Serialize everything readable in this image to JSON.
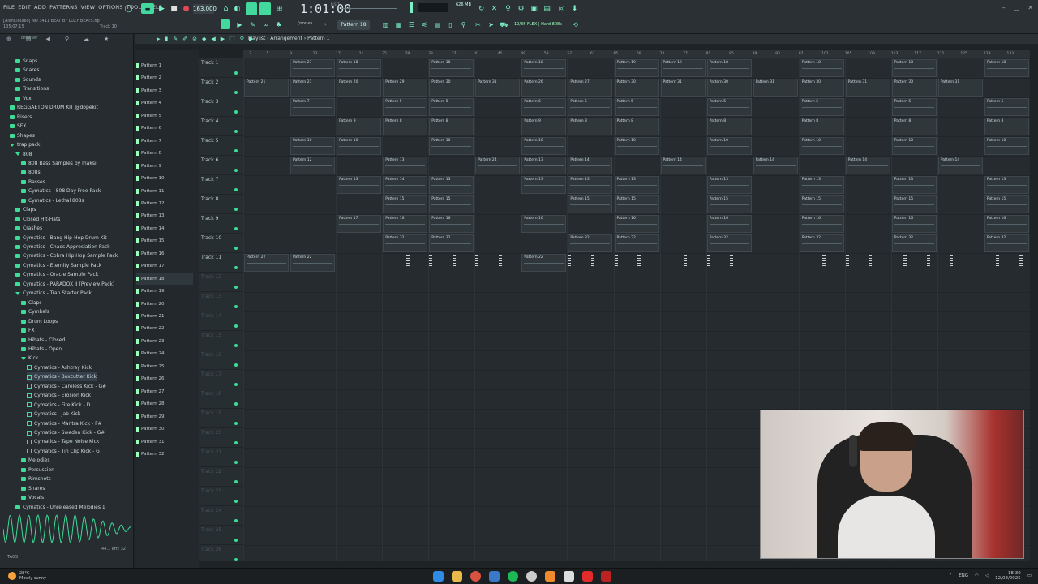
{
  "menu": [
    "FILE",
    "EDIT",
    "ADD",
    "PATTERNS",
    "VIEW",
    "OPTIONS",
    "TOOLS",
    "HELP"
  ],
  "hint": {
    "line1": "[AllInCloudio] NO 3411 BEAT BY LUZY BEATS.flp",
    "line2": "135:07:15",
    "track_hint": "Track 10"
  },
  "transport": {
    "tempo": "163.000",
    "time": "1:01:00",
    "time_small": "B:S:T",
    "cpu": "626 MB"
  },
  "toolbar2": {
    "mode": "(none)",
    "pattern": "Pattern 18",
    "flex": "10/35 FLEX | Hard 808s"
  },
  "browser": {
    "title": "Browser",
    "items": [
      {
        "label": "Snaps",
        "lvl": 1,
        "t": "folder"
      },
      {
        "label": "Snares",
        "lvl": 1,
        "t": "folder"
      },
      {
        "label": "Sounds",
        "lvl": 1,
        "t": "folder"
      },
      {
        "label": "Transitions",
        "lvl": 1,
        "t": "folder"
      },
      {
        "label": "Vox",
        "lvl": 1,
        "t": "folder"
      },
      {
        "label": "REGGAETON DRUM KIT @dopekit",
        "lvl": 0,
        "t": "folder"
      },
      {
        "label": "Risers",
        "lvl": 0,
        "t": "folder"
      },
      {
        "label": "SFX",
        "lvl": 0,
        "t": "folder"
      },
      {
        "label": "Shapes",
        "lvl": 0,
        "t": "folder"
      },
      {
        "label": "trap pack",
        "lvl": 0,
        "t": "open"
      },
      {
        "label": "808",
        "lvl": 1,
        "t": "open"
      },
      {
        "label": "808 Bass Samples by Ihaksi",
        "lvl": 2,
        "t": "folder"
      },
      {
        "label": "808s",
        "lvl": 2,
        "t": "folder"
      },
      {
        "label": "Basses",
        "lvl": 2,
        "t": "folder"
      },
      {
        "label": "Cymatics - 808 Day Free Pack",
        "lvl": 2,
        "t": "folder"
      },
      {
        "label": "Cymatics - Lethal 808s",
        "lvl": 2,
        "t": "folder"
      },
      {
        "label": "Claps",
        "lvl": 1,
        "t": "folder"
      },
      {
        "label": "Closed Hit-Hats",
        "lvl": 1,
        "t": "folder"
      },
      {
        "label": "Crashes",
        "lvl": 1,
        "t": "folder"
      },
      {
        "label": "Cymatics - Bang Hip-Hop Drum Kit",
        "lvl": 1,
        "t": "folder"
      },
      {
        "label": "Cymatics - Chaos Appreciation Pack",
        "lvl": 1,
        "t": "folder"
      },
      {
        "label": "Cymatics - Cobra Hip Hop Sample Pack",
        "lvl": 1,
        "t": "folder"
      },
      {
        "label": "Cymatics - Eternity Sample Pack",
        "lvl": 1,
        "t": "folder"
      },
      {
        "label": "Cymatics - Oracle Sample Pack",
        "lvl": 1,
        "t": "folder"
      },
      {
        "label": "Cymatics - PARADOX II (Preview Pack)",
        "lvl": 1,
        "t": "folder"
      },
      {
        "label": "Cymatics - Trap Starter Pack",
        "lvl": 1,
        "t": "open"
      },
      {
        "label": "Claps",
        "lvl": 2,
        "t": "folder"
      },
      {
        "label": "Cymbals",
        "lvl": 2,
        "t": "folder"
      },
      {
        "label": "Drum Loops",
        "lvl": 2,
        "t": "folder"
      },
      {
        "label": "FX",
        "lvl": 2,
        "t": "folder"
      },
      {
        "label": "Hihats - Closed",
        "lvl": 2,
        "t": "folder"
      },
      {
        "label": "Hihats - Open",
        "lvl": 2,
        "t": "folder"
      },
      {
        "label": "Kick",
        "lvl": 2,
        "t": "open"
      },
      {
        "label": "Cymatics - Ashtray Kick",
        "lvl": 3,
        "t": "file"
      },
      {
        "label": "Cymatics - Boxcutter Kick",
        "lvl": 3,
        "t": "file",
        "sel": true
      },
      {
        "label": "Cymatics - Careless Kick - G#",
        "lvl": 3,
        "t": "file"
      },
      {
        "label": "Cymatics - Erosion Kick",
        "lvl": 3,
        "t": "file"
      },
      {
        "label": "Cymatics - Fire Kick - D",
        "lvl": 3,
        "t": "file"
      },
      {
        "label": "Cymatics - Jab Kick",
        "lvl": 3,
        "t": "file"
      },
      {
        "label": "Cymatics - Mantra Kick - F#",
        "lvl": 3,
        "t": "file"
      },
      {
        "label": "Cymatics - Sweden Kick - G#",
        "lvl": 3,
        "t": "file"
      },
      {
        "label": "Cymatics - Tape Noise Kick",
        "lvl": 3,
        "t": "file"
      },
      {
        "label": "Cymatics - Tin Clip Kick - G",
        "lvl": 3,
        "t": "file"
      },
      {
        "label": "Melodies",
        "lvl": 2,
        "t": "folder"
      },
      {
        "label": "Percussion",
        "lvl": 2,
        "t": "folder"
      },
      {
        "label": "Rimshots",
        "lvl": 2,
        "t": "folder"
      },
      {
        "label": "Snares",
        "lvl": 2,
        "t": "folder"
      },
      {
        "label": "Vocals",
        "lvl": 2,
        "t": "folder"
      },
      {
        "label": "Cymatics - Unreleased Melodies 1",
        "lvl": 1,
        "t": "folder"
      }
    ],
    "tags": "TAGS",
    "samplerate": "44.1 kHz 32"
  },
  "playlist": {
    "breadcrumb": "Playlist - Arrangement › Pattern 1"
  },
  "patterns": [
    "Pattern 1",
    "Pattern 2",
    "Pattern 3",
    "Pattern 4",
    "Pattern 5",
    "Pattern 6",
    "Pattern 7",
    "Pattern 8",
    "Pattern 9",
    "Pattern 10",
    "Pattern 11",
    "Pattern 12",
    "Pattern 13",
    "Pattern 14",
    "Pattern 15",
    "Pattern 16",
    "Pattern 17",
    "Pattern 18",
    "Pattern 19",
    "Pattern 20",
    "Pattern 21",
    "Pattern 22",
    "Pattern 23",
    "Pattern 24",
    "Pattern 25",
    "Pattern 26",
    "Pattern 27",
    "Pattern 28",
    "Pattern 29",
    "Pattern 30",
    "Pattern 31",
    "Pattern 32"
  ],
  "tracks": [
    "Track 1",
    "Track 2",
    "Track 3",
    "Track 4",
    "Track 5",
    "Track 6",
    "Track 7",
    "Track 8",
    "Track 9",
    "Track 10",
    "Track 11",
    "Track 12",
    "Track 13",
    "Track 14",
    "Track 15",
    "Track 16",
    "Track 17",
    "Track 18",
    "Track 19",
    "Track 20",
    "Track 21",
    "Track 22",
    "Track 23",
    "Track 24",
    "Track 25",
    "Track 26"
  ],
  "ruler": [
    "2",
    "5",
    "9",
    "13",
    "17",
    "21",
    "25",
    "29",
    "33",
    "37",
    "41",
    "45",
    "49",
    "53",
    "57",
    "61",
    "65",
    "69",
    "73",
    "77",
    "81",
    "85",
    "89",
    "93",
    "97",
    "101",
    "105",
    "109",
    "113",
    "117",
    "121",
    "125",
    "129",
    "133"
  ],
  "clips": [
    {
      "t": 0,
      "b": 4,
      "e": 8,
      "l": "Pattern 27"
    },
    {
      "t": 0,
      "b": 8,
      "e": 12,
      "l": "Pattern 18"
    },
    {
      "t": 0,
      "b": 16,
      "e": 20,
      "l": "Pattern 18"
    },
    {
      "t": 0,
      "b": 24,
      "e": 28,
      "l": "Pattern 18"
    },
    {
      "t": 0,
      "b": 32,
      "e": 36,
      "l": "Pattern 19"
    },
    {
      "t": 0,
      "b": 36,
      "e": 40,
      "l": "Pattern 19"
    },
    {
      "t": 0,
      "b": 40,
      "e": 44,
      "l": "Pattern 18"
    },
    {
      "t": 0,
      "b": 48,
      "e": 52,
      "l": "Pattern 18"
    },
    {
      "t": 0,
      "b": 56,
      "e": 60,
      "l": "Pattern 18"
    },
    {
      "t": 0,
      "b": 64,
      "e": 68,
      "l": "Pattern 18"
    },
    {
      "t": 0,
      "b": 72,
      "e": 76,
      "l": "Pattern 18"
    },
    {
      "t": 1,
      "b": 0,
      "e": 4,
      "l": "Pattern 21"
    },
    {
      "t": 1,
      "b": 4,
      "e": 8,
      "l": "Pattern 21"
    },
    {
      "t": 1,
      "b": 8,
      "e": 12,
      "l": "Pattern 20"
    },
    {
      "t": 1,
      "b": 12,
      "e": 16,
      "l": "Pattern 29"
    },
    {
      "t": 1,
      "b": 16,
      "e": 20,
      "l": "Pattern 30"
    },
    {
      "t": 1,
      "b": 20,
      "e": 24,
      "l": "Pattern 31"
    },
    {
      "t": 1,
      "b": 24,
      "e": 28,
      "l": "Pattern 26"
    },
    {
      "t": 1,
      "b": 28,
      "e": 32,
      "l": "Pattern 27"
    },
    {
      "t": 1,
      "b": 32,
      "e": 36,
      "l": "Pattern 30"
    },
    {
      "t": 1,
      "b": 36,
      "e": 40,
      "l": "Pattern 31"
    },
    {
      "t": 1,
      "b": 40,
      "e": 44,
      "l": "Pattern 30"
    },
    {
      "t": 1,
      "b": 44,
      "e": 48,
      "l": "Pattern 31"
    },
    {
      "t": 1,
      "b": 48,
      "e": 52,
      "l": "Pattern 30"
    },
    {
      "t": 1,
      "b": 52,
      "e": 56,
      "l": "Pattern 31"
    },
    {
      "t": 1,
      "b": 56,
      "e": 60,
      "l": "Pattern 30"
    },
    {
      "t": 1,
      "b": 60,
      "e": 64,
      "l": "Pattern 31"
    },
    {
      "t": 2,
      "b": 4,
      "e": 8,
      "l": "Pattern 7"
    },
    {
      "t": 2,
      "b": 12,
      "e": 16,
      "l": "Pattern 5"
    },
    {
      "t": 2,
      "b": 16,
      "e": 20,
      "l": "Pattern 5"
    },
    {
      "t": 2,
      "b": 24,
      "e": 28,
      "l": "Pattern 6"
    },
    {
      "t": 2,
      "b": 28,
      "e": 32,
      "l": "Pattern 5"
    },
    {
      "t": 2,
      "b": 32,
      "e": 36,
      "l": "Pattern 5"
    },
    {
      "t": 2,
      "b": 40,
      "e": 44,
      "l": "Pattern 5"
    },
    {
      "t": 2,
      "b": 48,
      "e": 52,
      "l": "Pattern 5"
    },
    {
      "t": 2,
      "b": 56,
      "e": 60,
      "l": "Pattern 5"
    },
    {
      "t": 2,
      "b": 64,
      "e": 68,
      "l": "Pattern 5"
    },
    {
      "t": 3,
      "b": 8,
      "e": 12,
      "l": "Pattern 9"
    },
    {
      "t": 3,
      "b": 12,
      "e": 16,
      "l": "Pattern 8"
    },
    {
      "t": 3,
      "b": 16,
      "e": 20,
      "l": "Pattern 8"
    },
    {
      "t": 3,
      "b": 24,
      "e": 28,
      "l": "Pattern 9"
    },
    {
      "t": 3,
      "b": 28,
      "e": 32,
      "l": "Pattern 8"
    },
    {
      "t": 3,
      "b": 32,
      "e": 36,
      "l": "Pattern 8"
    },
    {
      "t": 3,
      "b": 40,
      "e": 44,
      "l": "Pattern 8"
    },
    {
      "t": 3,
      "b": 48,
      "e": 52,
      "l": "Pattern 8"
    },
    {
      "t": 3,
      "b": 56,
      "e": 60,
      "l": "Pattern 8"
    },
    {
      "t": 3,
      "b": 64,
      "e": 68,
      "l": "Pattern 8"
    },
    {
      "t": 4,
      "b": 4,
      "e": 8,
      "l": "Pattern 10"
    },
    {
      "t": 4,
      "b": 8,
      "e": 12,
      "l": "Pattern 10"
    },
    {
      "t": 4,
      "b": 16,
      "e": 20,
      "l": "Pattern 10"
    },
    {
      "t": 4,
      "b": 24,
      "e": 28,
      "l": "Pattern 10"
    },
    {
      "t": 4,
      "b": 32,
      "e": 36,
      "l": "Pattern 10"
    },
    {
      "t": 4,
      "b": 40,
      "e": 44,
      "l": "Pattern 10"
    },
    {
      "t": 4,
      "b": 48,
      "e": 52,
      "l": "Pattern 10"
    },
    {
      "t": 4,
      "b": 56,
      "e": 60,
      "l": "Pattern 10"
    },
    {
      "t": 4,
      "b": 64,
      "e": 68,
      "l": "Pattern 10"
    },
    {
      "t": 5,
      "b": 4,
      "e": 8,
      "l": "Pattern 12"
    },
    {
      "t": 5,
      "b": 12,
      "e": 16,
      "l": "Pattern 13"
    },
    {
      "t": 5,
      "b": 20,
      "e": 24,
      "l": "Pattern 24"
    },
    {
      "t": 5,
      "b": 24,
      "e": 28,
      "l": "Pattern 13"
    },
    {
      "t": 5,
      "b": 28,
      "e": 32,
      "l": "Pattern 14"
    },
    {
      "t": 5,
      "b": 36,
      "e": 40,
      "l": "Pattern 14"
    },
    {
      "t": 5,
      "b": 44,
      "e": 48,
      "l": "Pattern 14"
    },
    {
      "t": 5,
      "b": 52,
      "e": 56,
      "l": "Pattern 14"
    },
    {
      "t": 5,
      "b": 60,
      "e": 64,
      "l": "Pattern 14"
    },
    {
      "t": 5,
      "b": 68,
      "e": 72,
      "l": "Pattern 14"
    },
    {
      "t": 6,
      "b": 8,
      "e": 12,
      "l": "Pattern 13"
    },
    {
      "t": 6,
      "b": 12,
      "e": 16,
      "l": "Pattern 14"
    },
    {
      "t": 6,
      "b": 16,
      "e": 20,
      "l": "Pattern 13"
    },
    {
      "t": 6,
      "b": 24,
      "e": 28,
      "l": "Pattern 13"
    },
    {
      "t": 6,
      "b": 28,
      "e": 32,
      "l": "Pattern 13"
    },
    {
      "t": 6,
      "b": 32,
      "e": 36,
      "l": "Pattern 13"
    },
    {
      "t": 6,
      "b": 40,
      "e": 44,
      "l": "Pattern 13"
    },
    {
      "t": 6,
      "b": 48,
      "e": 52,
      "l": "Pattern 13"
    },
    {
      "t": 6,
      "b": 56,
      "e": 60,
      "l": "Pattern 13"
    },
    {
      "t": 6,
      "b": 64,
      "e": 68,
      "l": "Pattern 13"
    },
    {
      "t": 7,
      "b": 12,
      "e": 16,
      "l": "Pattern 15"
    },
    {
      "t": 7,
      "b": 16,
      "e": 20,
      "l": "Pattern 15"
    },
    {
      "t": 7,
      "b": 28,
      "e": 32,
      "l": "Pattern 15"
    },
    {
      "t": 7,
      "b": 32,
      "e": 36,
      "l": "Pattern 15"
    },
    {
      "t": 7,
      "b": 40,
      "e": 44,
      "l": "Pattern 15"
    },
    {
      "t": 7,
      "b": 48,
      "e": 52,
      "l": "Pattern 15"
    },
    {
      "t": 7,
      "b": 56,
      "e": 60,
      "l": "Pattern 15"
    },
    {
      "t": 7,
      "b": 64,
      "e": 68,
      "l": "Pattern 15"
    },
    {
      "t": 8,
      "b": 8,
      "e": 12,
      "l": "Pattern 17"
    },
    {
      "t": 8,
      "b": 12,
      "e": 16,
      "l": "Pattern 16"
    },
    {
      "t": 8,
      "b": 16,
      "e": 20,
      "l": "Pattern 16"
    },
    {
      "t": 8,
      "b": 24,
      "e": 28,
      "l": "Pattern 16"
    },
    {
      "t": 8,
      "b": 32,
      "e": 36,
      "l": "Pattern 16"
    },
    {
      "t": 8,
      "b": 40,
      "e": 44,
      "l": "Pattern 16"
    },
    {
      "t": 8,
      "b": 48,
      "e": 52,
      "l": "Pattern 16"
    },
    {
      "t": 8,
      "b": 56,
      "e": 60,
      "l": "Pattern 16"
    },
    {
      "t": 8,
      "b": 64,
      "e": 68,
      "l": "Pattern 16"
    },
    {
      "t": 9,
      "b": 12,
      "e": 16,
      "l": "Pattern 32"
    },
    {
      "t": 9,
      "b": 16,
      "e": 20,
      "l": "Pattern 32"
    },
    {
      "t": 9,
      "b": 28,
      "e": 32,
      "l": "Pattern 32"
    },
    {
      "t": 9,
      "b": 32,
      "e": 36,
      "l": "Pattern 32"
    },
    {
      "t": 9,
      "b": 40,
      "e": 44,
      "l": "Pattern 32"
    },
    {
      "t": 9,
      "b": 48,
      "e": 52,
      "l": "Pattern 32"
    },
    {
      "t": 9,
      "b": 56,
      "e": 60,
      "l": "Pattern 32"
    },
    {
      "t": 9,
      "b": 64,
      "e": 68,
      "l": "Pattern 32"
    },
    {
      "t": 10,
      "b": 0,
      "e": 4,
      "l": "Pattern 22"
    },
    {
      "t": 10,
      "b": 4,
      "e": 8,
      "l": "Pattern 22"
    },
    {
      "t": 10,
      "b": 24,
      "e": 28,
      "l": "Pattern 22"
    }
  ],
  "minis": [
    14,
    16,
    18,
    20,
    22,
    28,
    30,
    32,
    34,
    38,
    40,
    42,
    50,
    52,
    54,
    57,
    59,
    61,
    65,
    67,
    69
  ],
  "taskbar": {
    "temp": "28°C",
    "weather": "Mostly sunny",
    "lang": "ENG",
    "time": "18:30",
    "date": "12/08/2025"
  }
}
